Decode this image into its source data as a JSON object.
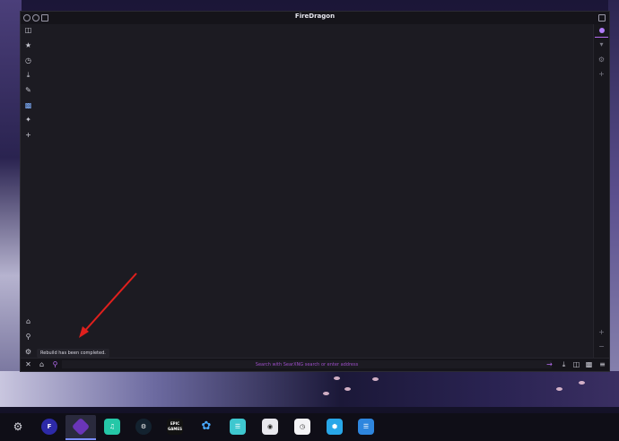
{
  "window": {
    "title": "FireDragon"
  },
  "url_bar": {
    "placeholder": "Search with SearXNG search or enter address"
  },
  "toast": {
    "message": "Rebuild has been completed."
  },
  "colors": {
    "accent": "#b56cf0",
    "arrow": "#e0201d"
  },
  "sidebar_icons": [
    "tabs-icon",
    "bookmarks-icon",
    "history-icon",
    "downloads-icon",
    "edit-icon",
    "screenshots-icon",
    "extensions-icon",
    "add-panel-icon"
  ],
  "taskbar_apps": [
    "settings-icon",
    "firedragon-app-icon",
    "active-app-icon",
    "music-app-icon",
    "steam-app-icon",
    "epic-games-app-icon",
    "dragon-app-icon",
    "chat-app-icon",
    "disk-app-icon",
    "clock-app-icon",
    "hexagon-app-icon",
    "network-app-icon"
  ],
  "taskbar": {
    "epic_label": "EPIC GAMES"
  }
}
